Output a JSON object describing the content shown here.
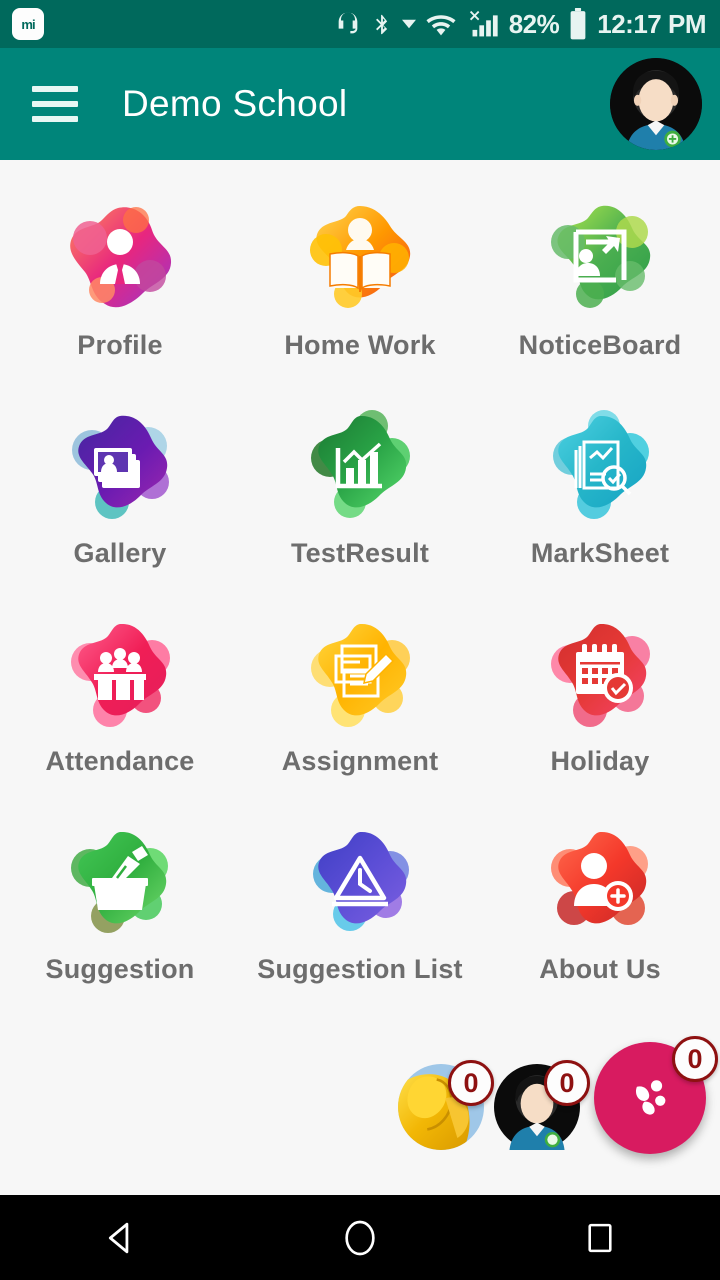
{
  "statusbar": {
    "brand_logo": "mi-logo",
    "icons": [
      "headset-icon",
      "bluetooth-icon",
      "dropdown-caret-icon",
      "wifi-icon",
      "mobile-signal-icon"
    ],
    "battery_percent": "82%",
    "battery_icon": "battery-icon",
    "time": "12:17 PM"
  },
  "appbar": {
    "menu_icon": "hamburger-menu-icon",
    "title": "Demo School",
    "avatar": "user-avatar",
    "bg_color": "#00857a"
  },
  "grid": {
    "tiles": [
      {
        "label": "Profile",
        "icon": "profile-icon",
        "color": "#e91e63"
      },
      {
        "label": "Home Work",
        "icon": "home-work-icon",
        "color": "#f57c00"
      },
      {
        "label": "NoticeBoard",
        "icon": "notice-board-icon",
        "color": "#4caf50"
      },
      {
        "label": "Gallery",
        "icon": "gallery-icon",
        "color": "#5e35b1"
      },
      {
        "label": "TestResult",
        "icon": "test-result-icon",
        "color": "#2e9e49"
      },
      {
        "label": "MarkSheet",
        "icon": "mark-sheet-icon",
        "color": "#26c6da"
      },
      {
        "label": "Attendance",
        "icon": "attendance-icon",
        "color": "#ef2b5e"
      },
      {
        "label": "Assignment",
        "icon": "assignment-icon",
        "color": "#ffc107"
      },
      {
        "label": "Holiday",
        "icon": "holiday-icon",
        "color": "#e53935"
      },
      {
        "label": "Suggestion",
        "icon": "suggestion-icon",
        "color": "#2fae3e"
      },
      {
        "label": "Suggestion List",
        "icon": "suggestion-list-icon",
        "color": "#3f51b5"
      },
      {
        "label": "About Us",
        "icon": "about-us-icon",
        "color": "#f4382a"
      }
    ]
  },
  "fabs": {
    "items": [
      {
        "name": "gallery-fab",
        "badge": "0"
      },
      {
        "name": "profile-fab",
        "badge": "0"
      },
      {
        "name": "main-action-fab",
        "badge": "0"
      }
    ],
    "main_color": "#d81b60"
  },
  "navbar": {
    "back": "back-triangle-icon",
    "home": "home-circle-icon",
    "recents": "recents-square-icon"
  }
}
